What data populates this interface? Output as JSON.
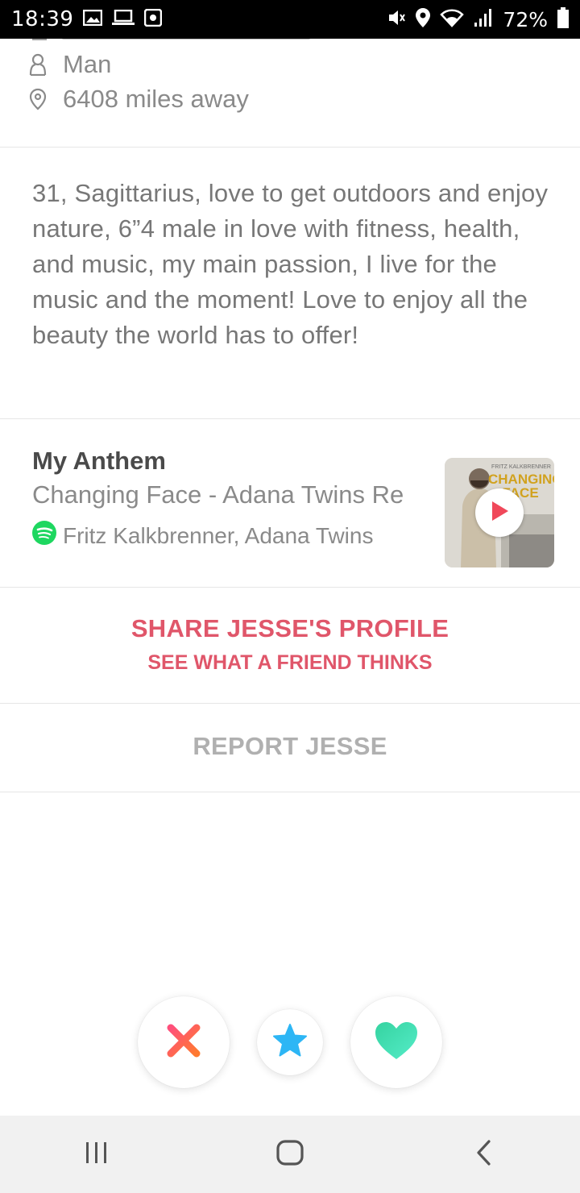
{
  "status_bar": {
    "time": "18:39",
    "battery": "72%",
    "icons_left": [
      "image-icon",
      "laptop-icon",
      "screen-record-icon"
    ],
    "icons_right": [
      "mute-icon",
      "location-icon",
      "wifi-icon",
      "signal-icon",
      "battery-icon"
    ]
  },
  "profile": {
    "gender": "Man",
    "distance": "6408 miles away",
    "bio": "31, Sagittarius, love to get outdoors and enjoy nature, 6”4 male in love with fitness, health, and music, my main passion, I live for the music and the moment! Love to enjoy all the beauty the world has to offer!"
  },
  "anthem": {
    "title": "My Anthem",
    "song": "Changing Face - Adana Twins Re",
    "artists": "Fritz Kalkbrenner, Adana Twins",
    "album_art_text_small": "FRITZ KALKBRENNER",
    "album_art_text_large": "CHANGING FACE"
  },
  "share": {
    "title": "SHARE JESSE'S PROFILE",
    "subtitle": "SEE WHAT A FRIEND THINKS"
  },
  "report": {
    "label": "REPORT JESSE"
  },
  "colors": {
    "brand_red": "#e0566a",
    "nope": "#f2575f",
    "super_like": "#2db6f5",
    "like": "#3de0b2",
    "spotify": "#1ed760"
  }
}
